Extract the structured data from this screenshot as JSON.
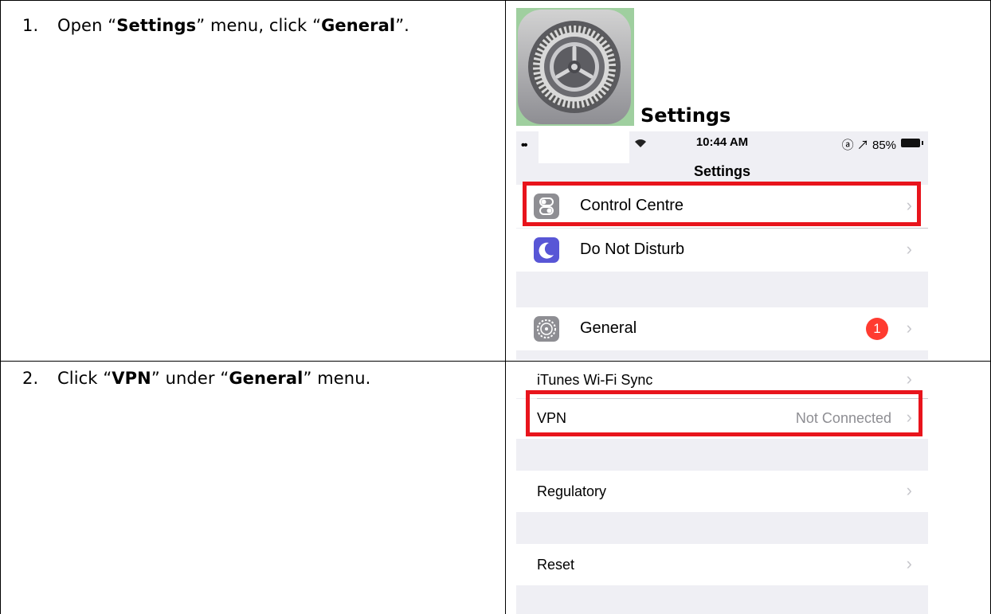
{
  "steps": [
    {
      "number": "1.",
      "pre": "Open “",
      "bold1": "Settings",
      "mid": "” menu, click “",
      "bold2": "General",
      "post": "”."
    },
    {
      "number": "2.",
      "pre": "Click “",
      "bold1": "VPN",
      "mid": "” under “",
      "bold2": "General",
      "post": "” menu."
    }
  ],
  "app_icon": {
    "caption": "Settings",
    "icon": "gear-icon"
  },
  "status_bar": {
    "signal": "••",
    "time": "10:44 AM",
    "right": "ⓐ ↗ 85%"
  },
  "settings_screen": {
    "title": "Settings",
    "rows": [
      {
        "label": "Control Centre",
        "icon": "control-centre-icon",
        "icon_color": "#8e8e93"
      },
      {
        "label": "Do Not Disturb",
        "icon": "moon-icon",
        "icon_color": "#5856d6"
      },
      {
        "label": "General",
        "icon": "gear-icon",
        "icon_color": "#8e8e93",
        "badge": "1"
      }
    ]
  },
  "general_screen": {
    "rows": [
      {
        "label": "iTunes Wi-Fi Sync"
      },
      {
        "label": "VPN",
        "value": "Not Connected"
      },
      {
        "label": "Regulatory"
      },
      {
        "label": "Reset"
      }
    ]
  },
  "colors": {
    "highlight": "#e8141c",
    "badge": "#ff3b30",
    "group_bg": "#efeff4"
  }
}
